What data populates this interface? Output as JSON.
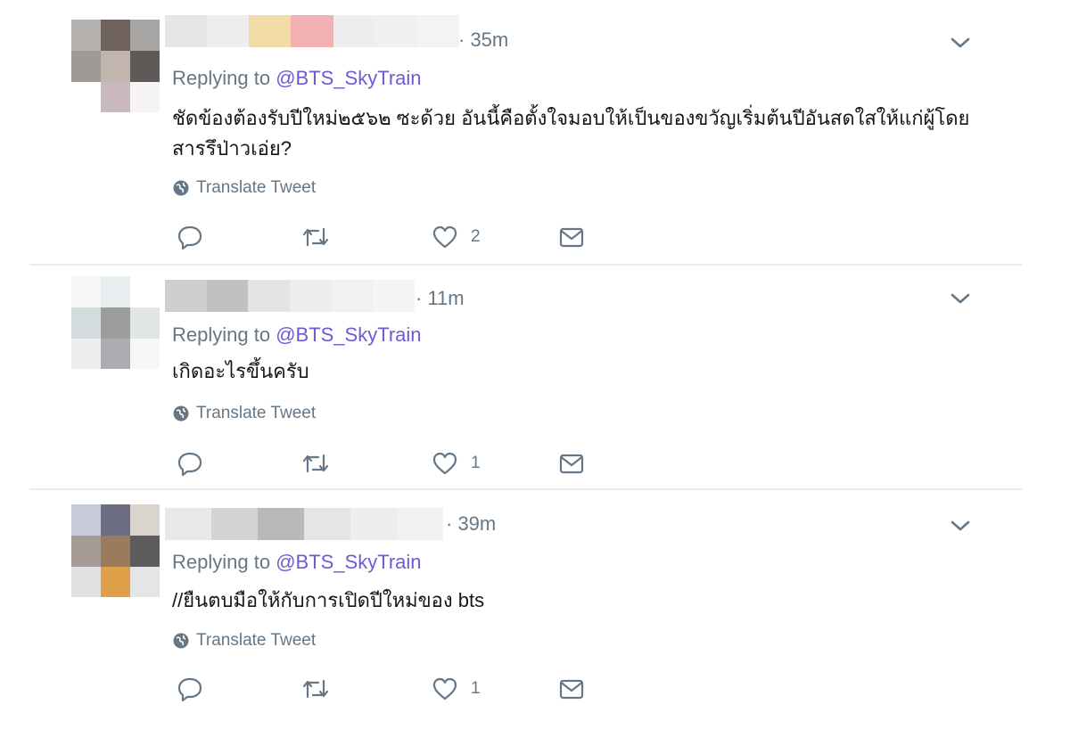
{
  "tweets": [
    {
      "time": "· 35m",
      "replying_prefix": "Replying to ",
      "handle": "@BTS_SkyTrain",
      "text": "ชัดข้องต้องรับปีใหม่๒๕๖๒ ซะด้วย อันนี้คือตั้งใจมอบให้เป็นของขวัญเริ่มต้นปีอันสดใสให้แก่ผู้โดยสารรึป่าวเอ่ย?",
      "translate": "Translate Tweet",
      "likes": "2",
      "avatar_colors": [
        "#b3b0ad",
        "#6f625b",
        "#a8a6a4",
        "#9d9a97",
        "#c1b5ad",
        "#5e5a58",
        "#ffffff",
        "#c9b9bd",
        "#f6f4f6"
      ],
      "name_colors": [
        "#e7e5e6",
        "#efeeee",
        "#f2dca6",
        "#f2b2b3",
        "#eeeeef",
        "#f1f0f1",
        "#f3f3f3"
      ]
    },
    {
      "time": "· 11m",
      "replying_prefix": "Replying to ",
      "handle": "@BTS_SkyTrain",
      "text": "เกิดอะไรขึ้นครับ",
      "translate": "Translate Tweet",
      "likes": "1",
      "avatar_colors": [
        "#f6f6f7",
        "#e8eef0",
        "#ffffff",
        "#d4dcdf",
        "#9d9d9e",
        "#e2e5e6",
        "#eeeeef",
        "#adacb2",
        "#f7f7f8"
      ],
      "name_colors": [
        "#cfcfd0",
        "#c1c1c2",
        "#e4e4e5",
        "#ededee",
        "#f1f1f2",
        "#f5f5f6"
      ]
    },
    {
      "time": "· 39m",
      "replying_prefix": "Replying to ",
      "handle": "@BTS_SkyTrain",
      "text": "//ยืนตบมือให้กับการเปิดปีใหม่ของ bts",
      "translate": "Translate Tweet",
      "likes": "1",
      "avatar_colors": [
        "#c8cbdc",
        "#6e6e83",
        "#dad4cf",
        "#a59a94",
        "#9b7b5e",
        "#5e5b5e",
        "#e1e0e2",
        "#e0a04a",
        "#e4e5e7"
      ],
      "name_colors": [
        "#e8e8e9",
        "#d3d3d4",
        "#b9b9ba",
        "#e5e5e6",
        "#ededee",
        "#f2f2f3"
      ]
    }
  ],
  "colors": {
    "accent": "#6b5bd6",
    "secondary_text": "#657786",
    "divider": "#e6ecf0"
  },
  "icons": [
    "reply-icon",
    "retweet-icon",
    "like-icon",
    "direct-message-icon",
    "globe-icon",
    "chevron-down-icon"
  ]
}
